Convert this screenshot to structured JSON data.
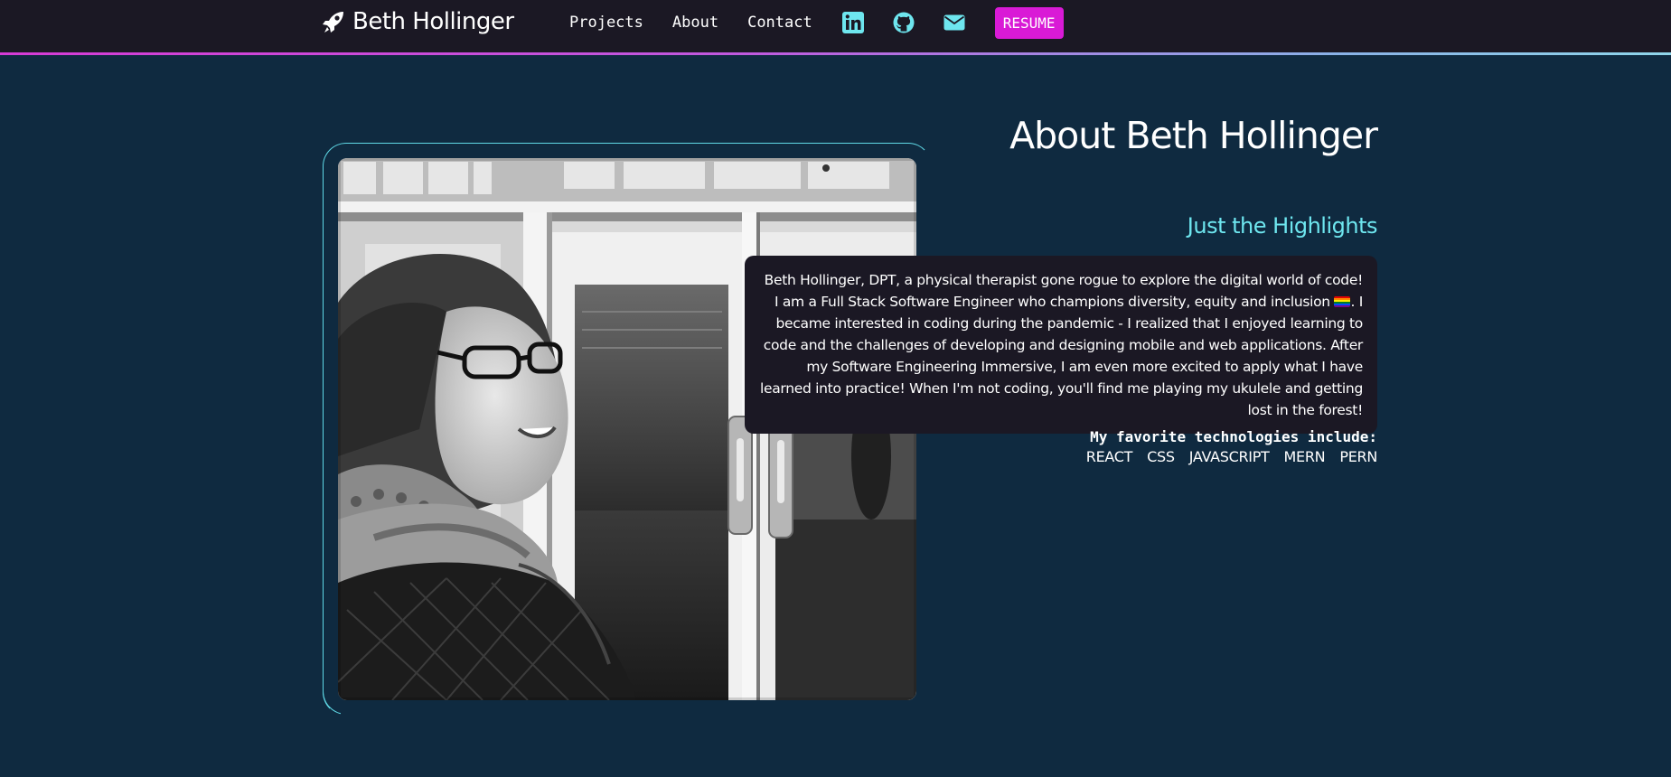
{
  "nav": {
    "brand": "Beth Hollinger",
    "links": [
      "Projects",
      "About",
      "Contact"
    ],
    "icons": [
      "linkedin-icon",
      "github-icon",
      "envelope-icon"
    ],
    "resume_label": "RESUME"
  },
  "about": {
    "title": "About Beth Hollinger",
    "highlights_title": "Just the Highlights",
    "bio_part1": "Beth Hollinger, DPT, a physical therapist gone rogue to explore the digital world of code! I am a Full Stack Software Engineer who champions diversity, equity and inclusion ",
    "bio_part2": ". I became interested in coding during the pandemic - I realized that I enjoyed learning to code and the challenges of developing and designing mobile and web applications. After my Software Engineering Immersive, I am even more excited to apply what I have learned into practice! When I'm not coding, you'll find me playing my ukulele and getting lost in the forest!",
    "tech_heading": "My favorite technologies include:",
    "technologies": [
      "REACT",
      "CSS",
      "JAVASCRIPT",
      "MERN",
      "PERN"
    ]
  },
  "colors": {
    "background": "#0f2a40",
    "navbar": "#1b1824",
    "accent_cyan": "#6ee6ef",
    "accent_magenta": "#d91ad6"
  }
}
